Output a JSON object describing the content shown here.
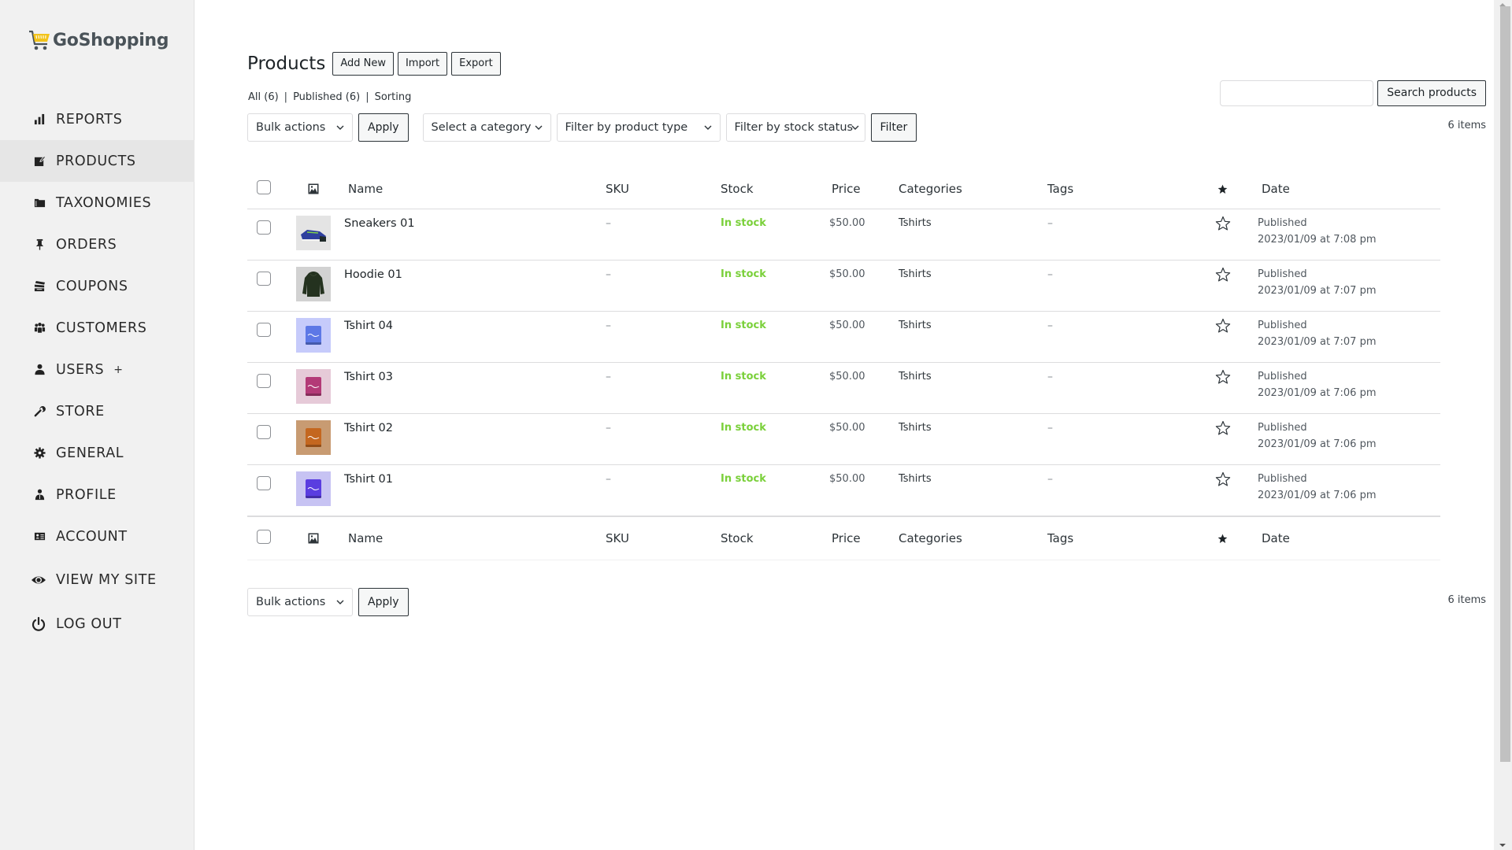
{
  "brand": {
    "name": "GoShopping",
    "accent": "#f2c31a"
  },
  "sidebar": {
    "items": [
      {
        "label": "REPORTS",
        "icon": "bar-chart-icon",
        "active": false
      },
      {
        "label": "PRODUCTS",
        "icon": "edit-icon",
        "active": true
      },
      {
        "label": "TAXONOMIES",
        "icon": "folder-icon",
        "active": false
      },
      {
        "label": "ORDERS",
        "icon": "pin-icon",
        "active": false
      },
      {
        "label": "COUPONS",
        "icon": "tickets-icon",
        "active": false
      },
      {
        "label": "CUSTOMERS",
        "icon": "group-icon",
        "active": false
      },
      {
        "label": "USERS",
        "icon": "user-icon",
        "active": false,
        "extra": "+"
      },
      {
        "label": "STORE",
        "icon": "wrench-icon",
        "active": false
      },
      {
        "label": "GENERAL",
        "icon": "gear-icon",
        "active": false
      },
      {
        "label": "PROFILE",
        "icon": "profile-icon",
        "active": false
      },
      {
        "label": "ACCOUNT",
        "icon": "id-card-icon",
        "active": false
      },
      {
        "label": "VIEW MY SITE",
        "icon": "eye-icon",
        "active": false
      },
      {
        "label": "LOG OUT",
        "icon": "power-icon",
        "active": false
      }
    ]
  },
  "header": {
    "title": "Products",
    "add_new": "Add New",
    "import": "Import",
    "export": "Export"
  },
  "views": {
    "all": "All (6)",
    "published": "Published (6)",
    "sorting": "Sorting",
    "separator": "|"
  },
  "filters": {
    "bulk_actions": "Bulk actions",
    "apply": "Apply",
    "category": "Select a category",
    "product_type": "Filter by product type",
    "stock_status": "Filter by stock status",
    "filter": "Filter"
  },
  "search": {
    "value": "",
    "placeholder": "",
    "button": "Search products"
  },
  "items_count": "6 items",
  "table": {
    "columns": {
      "name": "Name",
      "sku": "SKU",
      "stock": "Stock",
      "price": "Price",
      "categories": "Categories",
      "tags": "Tags",
      "date": "Date"
    },
    "in_stock_color": "#7ad03a",
    "rows": [
      {
        "name": "Sneakers 01",
        "thumb": "sneaker",
        "sku": "–",
        "stock": "In stock",
        "price": "$50.00",
        "categories": "Tshirts",
        "tags": "–",
        "featured": false,
        "status": "Published",
        "date": "2023/01/09 at 7:08 pm"
      },
      {
        "name": "Hoodie 01",
        "thumb": "hoodie",
        "sku": "–",
        "stock": "In stock",
        "price": "$50.00",
        "categories": "Tshirts",
        "tags": "–",
        "featured": false,
        "status": "Published",
        "date": "2023/01/09 at 7:07 pm"
      },
      {
        "name": "Tshirt 04",
        "thumb": "tshirt-blue",
        "sku": "–",
        "stock": "In stock",
        "price": "$50.00",
        "categories": "Tshirts",
        "tags": "–",
        "featured": false,
        "status": "Published",
        "date": "2023/01/09 at 7:07 pm"
      },
      {
        "name": "Tshirt 03",
        "thumb": "tshirt-magenta",
        "sku": "–",
        "stock": "In stock",
        "price": "$50.00",
        "categories": "Tshirts",
        "tags": "–",
        "featured": false,
        "status": "Published",
        "date": "2023/01/09 at 7:06 pm"
      },
      {
        "name": "Tshirt 02",
        "thumb": "tshirt-orange",
        "sku": "–",
        "stock": "In stock",
        "price": "$50.00",
        "categories": "Tshirts",
        "tags": "–",
        "featured": false,
        "status": "Published",
        "date": "2023/01/09 at 7:06 pm"
      },
      {
        "name": "Tshirt 01",
        "thumb": "tshirt-violet",
        "sku": "–",
        "stock": "In stock",
        "price": "$50.00",
        "categories": "Tshirts",
        "tags": "–",
        "featured": false,
        "status": "Published",
        "date": "2023/01/09 at 7:06 pm"
      }
    ]
  }
}
